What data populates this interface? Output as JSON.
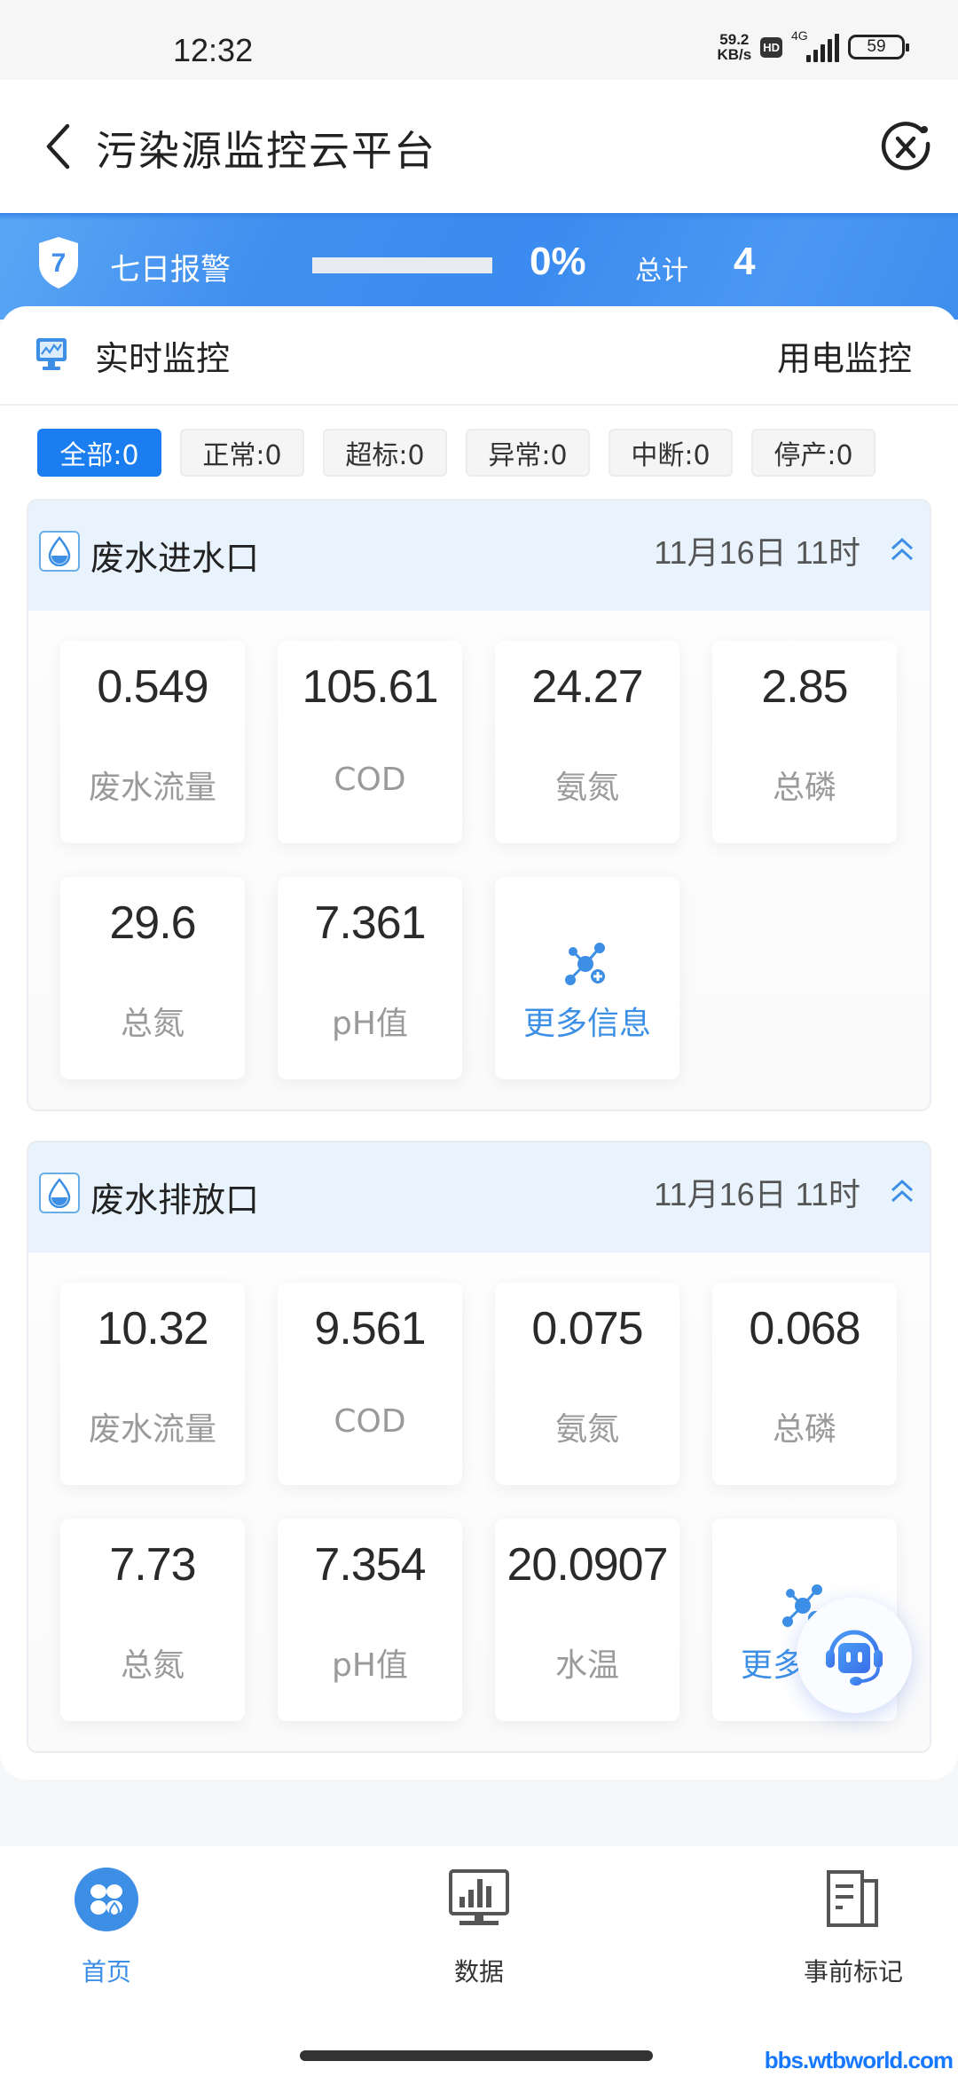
{
  "status_bar": {
    "time": "12:32",
    "net_speed_value": "59.2",
    "net_speed_unit": "KB/s",
    "hd_badge": "HD",
    "network_type": "4G",
    "battery": "59"
  },
  "header": {
    "title": "污染源监控云平台",
    "back_icon": "chevron-left-icon",
    "close_icon": "close-circle-icon"
  },
  "alert_banner": {
    "badge_number": "7",
    "label": "七日报警",
    "progress_fraction": 0,
    "percent_text": "0%",
    "total_label": "总计",
    "total_value": "4"
  },
  "tabs": {
    "realtime": "实时监控",
    "power": "用电监控"
  },
  "filters": [
    {
      "label": "全部:0",
      "active": true
    },
    {
      "label": "正常:0",
      "active": false
    },
    {
      "label": "超标:0",
      "active": false
    },
    {
      "label": "异常:0",
      "active": false
    },
    {
      "label": "中断:0",
      "active": false
    },
    {
      "label": "停产:0",
      "active": false
    }
  ],
  "stations": [
    {
      "name": "废水进水口",
      "time": "11月16日 11时",
      "metrics": [
        {
          "value": "0.549",
          "label": "废水流量"
        },
        {
          "value": "105.61",
          "label": "COD"
        },
        {
          "value": "24.27",
          "label": "氨氮"
        },
        {
          "value": "2.85",
          "label": "总磷"
        },
        {
          "value": "29.6",
          "label": "总氮"
        },
        {
          "value": "7.361",
          "label": "pH值"
        }
      ],
      "more_label": "更多信息"
    },
    {
      "name": "废水排放口",
      "time": "11月16日 11时",
      "metrics": [
        {
          "value": "10.32",
          "label": "废水流量"
        },
        {
          "value": "9.561",
          "label": "COD"
        },
        {
          "value": "0.075",
          "label": "氨氮"
        },
        {
          "value": "0.068",
          "label": "总磷"
        },
        {
          "value": "7.73",
          "label": "总氮"
        },
        {
          "value": "7.354",
          "label": "pH值"
        },
        {
          "value": "20.0907",
          "label": "水温"
        }
      ],
      "more_label": "更多信息"
    }
  ],
  "bottom_nav": [
    {
      "label": "首页",
      "icon": "home-clover-icon",
      "active": true
    },
    {
      "label": "数据",
      "icon": "data-monitor-icon",
      "active": false
    },
    {
      "label": "事前标记",
      "icon": "document-mark-icon",
      "active": false
    }
  ],
  "watermark": "bbs.wtbworld.com",
  "colors": {
    "primary": "#1b7ef0",
    "accent_blue": "#3d8fe6",
    "banner_blue": "#3f8eef",
    "station_header_bg": "#e9f3fd"
  }
}
